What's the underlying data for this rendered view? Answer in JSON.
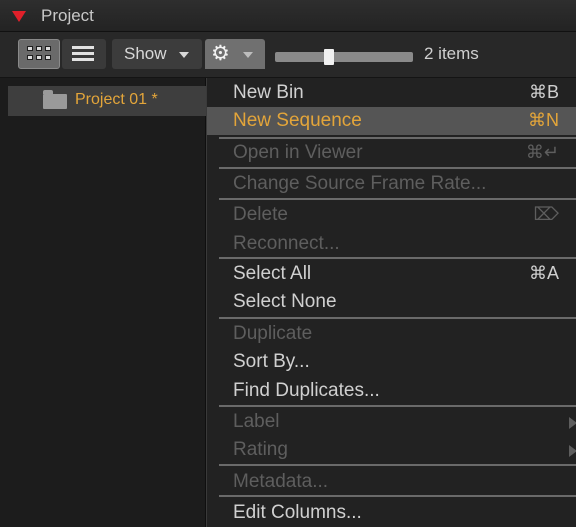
{
  "window": {
    "title": "Project"
  },
  "toolbar": {
    "show_label": "Show",
    "items_count": "2 items",
    "zoom_level": 0.38
  },
  "browser": {
    "project_name": "Project 01 *"
  },
  "menu": {
    "items": [
      {
        "label": "New Bin",
        "shortcut": "⌘B",
        "enabled": true
      },
      {
        "label": "New Sequence",
        "shortcut": "⌘N",
        "enabled": true,
        "highlighted": true
      },
      {
        "label": "Open in Viewer",
        "shortcut": "⌘↵",
        "enabled": false
      },
      {
        "label": "Change Source Frame Rate...",
        "shortcut": "",
        "enabled": false
      },
      {
        "label": "Delete",
        "shortcut": "⌦",
        "enabled": false
      },
      {
        "label": "Reconnect...",
        "shortcut": "",
        "enabled": false
      },
      {
        "label": "Select All",
        "shortcut": "⌘A",
        "enabled": true
      },
      {
        "label": "Select None",
        "shortcut": "",
        "enabled": true
      },
      {
        "label": "Duplicate",
        "shortcut": "",
        "enabled": false
      },
      {
        "label": "Sort By...",
        "shortcut": "",
        "enabled": true
      },
      {
        "label": "Find Duplicates...",
        "shortcut": "",
        "enabled": true
      },
      {
        "label": "Label",
        "shortcut": "",
        "enabled": false,
        "submenu": true
      },
      {
        "label": "Rating",
        "shortcut": "",
        "enabled": false,
        "submenu": true
      },
      {
        "label": "Metadata...",
        "shortcut": "",
        "enabled": false
      },
      {
        "label": "Edit Columns...",
        "shortcut": "",
        "enabled": true
      }
    ]
  },
  "colors": {
    "accent": "#e3a53a",
    "collapse_triangle": "#e0202a",
    "disabled_text": "#5e5e5e"
  }
}
